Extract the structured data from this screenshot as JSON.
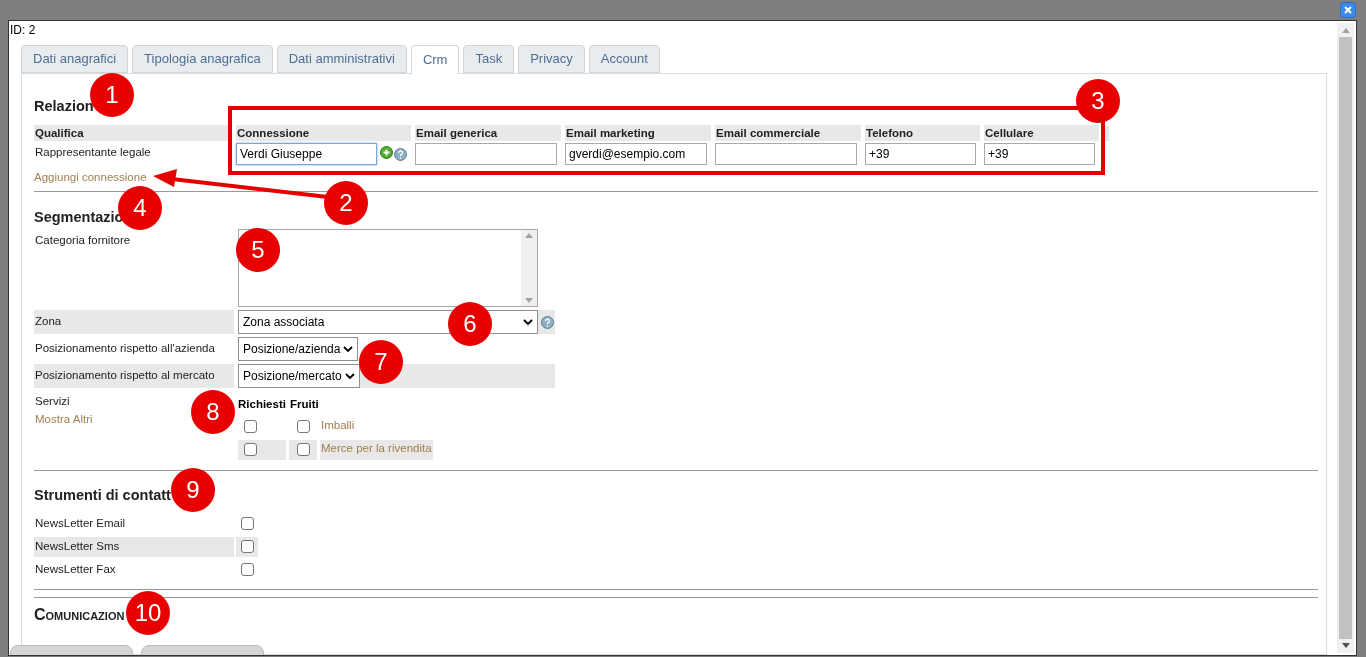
{
  "dialog": {
    "id_label": "ID: 2"
  },
  "tabs": [
    {
      "label": "Dati anagrafici",
      "selected": false
    },
    {
      "label": "Tipologia anagrafica",
      "selected": false
    },
    {
      "label": "Dati amministrativi",
      "selected": false
    },
    {
      "label": "Crm",
      "selected": true
    },
    {
      "label": "Task",
      "selected": false
    },
    {
      "label": "Privacy",
      "selected": false
    },
    {
      "label": "Account",
      "selected": false
    }
  ],
  "relations": {
    "title": "Relazion",
    "columns": [
      "Qualifica",
      "Connessione",
      "Email generica",
      "Email marketing",
      "Email commerciale",
      "Telefono",
      "Cellulare"
    ],
    "rows": [
      {
        "role": "Rappresentante legale",
        "fields": [
          {
            "kind": "contact",
            "value": "Verdi Giuseppe",
            "focused": true
          },
          {
            "kind": "text"
          },
          {
            "kind": "text",
            "value": "gverdi@esempio.com"
          },
          {
            "kind": "text"
          },
          {
            "kind": "text",
            "value": "+39"
          },
          {
            "kind": "text",
            "value": "+39"
          }
        ]
      }
    ],
    "add_link": "Aggiungi connessione"
  },
  "segmentation": {
    "title": "Segmentazio",
    "fields": [
      {
        "kind": "listbox",
        "label": "Categoria fornitore"
      },
      {
        "kind": "select",
        "label": "Zona",
        "value": "Zona associata",
        "help": true
      },
      {
        "kind": "select",
        "label": "Posizionamento rispetto all'azienda",
        "value": "Posizione/azienda"
      },
      {
        "kind": "select",
        "label": "Posizionamento rispetto al mercato",
        "value": "Posizione/mercato"
      }
    ],
    "services": {
      "label": "Servizi",
      "more_link": "Mostra Altri",
      "columns": [
        "Richiesti",
        "Fruiti"
      ],
      "rows": [
        {
          "name": "Imballi",
          "requested": false,
          "used": false
        },
        {
          "name": "Merce per la rivendita",
          "requested": false,
          "used": false
        }
      ]
    }
  },
  "contact_tools": {
    "title": "Strumenti di contatt",
    "rows": [
      {
        "label": "NewsLetter Email",
        "checked": false
      },
      {
        "label": "NewsLetter Sms",
        "checked": false
      },
      {
        "label": "NewsLetter Fax",
        "checked": false
      }
    ]
  },
  "communications": {
    "title": "Comunicazion"
  },
  "annotations": {
    "callouts": [
      "1",
      "2",
      "3",
      "4",
      "5",
      "6",
      "7",
      "8",
      "9",
      "10"
    ]
  }
}
